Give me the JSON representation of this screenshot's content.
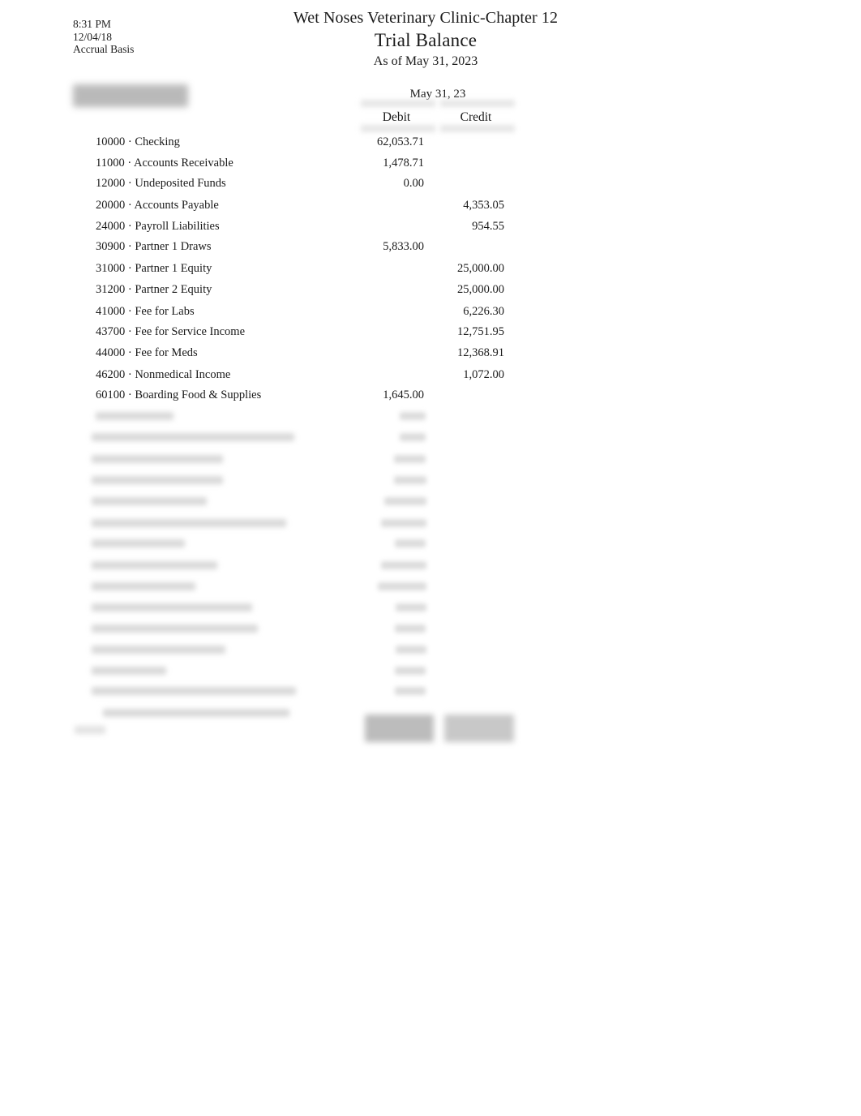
{
  "meta": {
    "time": "8:31 PM",
    "date": "12/04/18",
    "basis": "Accrual Basis"
  },
  "titles": {
    "company": "Wet Noses Veterinary Clinic-Chapter 12",
    "report": "Trial Balance",
    "as_of": "As of May 31, 2023"
  },
  "columns": {
    "period": "May 31, 23",
    "debit": "Debit",
    "credit": "Credit"
  },
  "rows": [
    {
      "label": "10000 · Checking",
      "debit": "62,053.71",
      "credit": ""
    },
    {
      "label": "11000 · Accounts Receivable",
      "debit": "1,478.71",
      "credit": ""
    },
    {
      "label": "12000 · Undeposited Funds",
      "debit": "0.00",
      "credit": ""
    },
    {
      "label": "20000 · Accounts Payable",
      "debit": "",
      "credit": "4,353.05"
    },
    {
      "label": "24000 · Payroll Liabilities",
      "debit": "",
      "credit": "954.55"
    },
    {
      "label": "30900 · Partner 1 Draws",
      "debit": "5,833.00",
      "credit": ""
    },
    {
      "label": "31000 · Partner 1 Equity",
      "debit": "",
      "credit": "25,000.00"
    },
    {
      "label": "31200 · Partner 2 Equity",
      "debit": "",
      "credit": "25,000.00"
    },
    {
      "label": "41000 · Fee for Labs",
      "debit": "",
      "credit": "6,226.30"
    },
    {
      "label": "43700 · Fee for Service Income",
      "debit": "",
      "credit": "12,751.95"
    },
    {
      "label": "44000 · Fee for Meds",
      "debit": "",
      "credit": "12,368.91"
    },
    {
      "label": "46200 · Nonmedical Income",
      "debit": "",
      "credit": "1,072.00"
    },
    {
      "label": "60100 · Boarding Food & Supplies",
      "debit": "1,645.00",
      "credit": ""
    }
  ],
  "redacted": {
    "note": "obscured",
    "header_block": {
      "label": ""
    },
    "rows": [
      {
        "label": "",
        "debit": "",
        "credit": ""
      },
      {
        "label": "",
        "debit": "",
        "credit": ""
      },
      {
        "label": "",
        "debit": "",
        "credit": ""
      },
      {
        "label": "",
        "debit": "",
        "credit": ""
      },
      {
        "label": "",
        "debit": "",
        "credit": ""
      },
      {
        "label": "",
        "debit": "",
        "credit": ""
      },
      {
        "label": "",
        "debit": "",
        "credit": ""
      },
      {
        "label": "",
        "debit": "",
        "credit": ""
      },
      {
        "label": "",
        "debit": "",
        "credit": ""
      },
      {
        "label": "",
        "debit": "",
        "credit": ""
      },
      {
        "label": "",
        "debit": "",
        "credit": ""
      },
      {
        "label": "",
        "debit": "",
        "credit": ""
      },
      {
        "label": "",
        "debit": "",
        "credit": ""
      },
      {
        "label": "",
        "debit": "",
        "credit": ""
      },
      {
        "label": "",
        "debit": "",
        "credit": ""
      }
    ],
    "total": {
      "label": "",
      "debit": "",
      "credit": ""
    }
  }
}
